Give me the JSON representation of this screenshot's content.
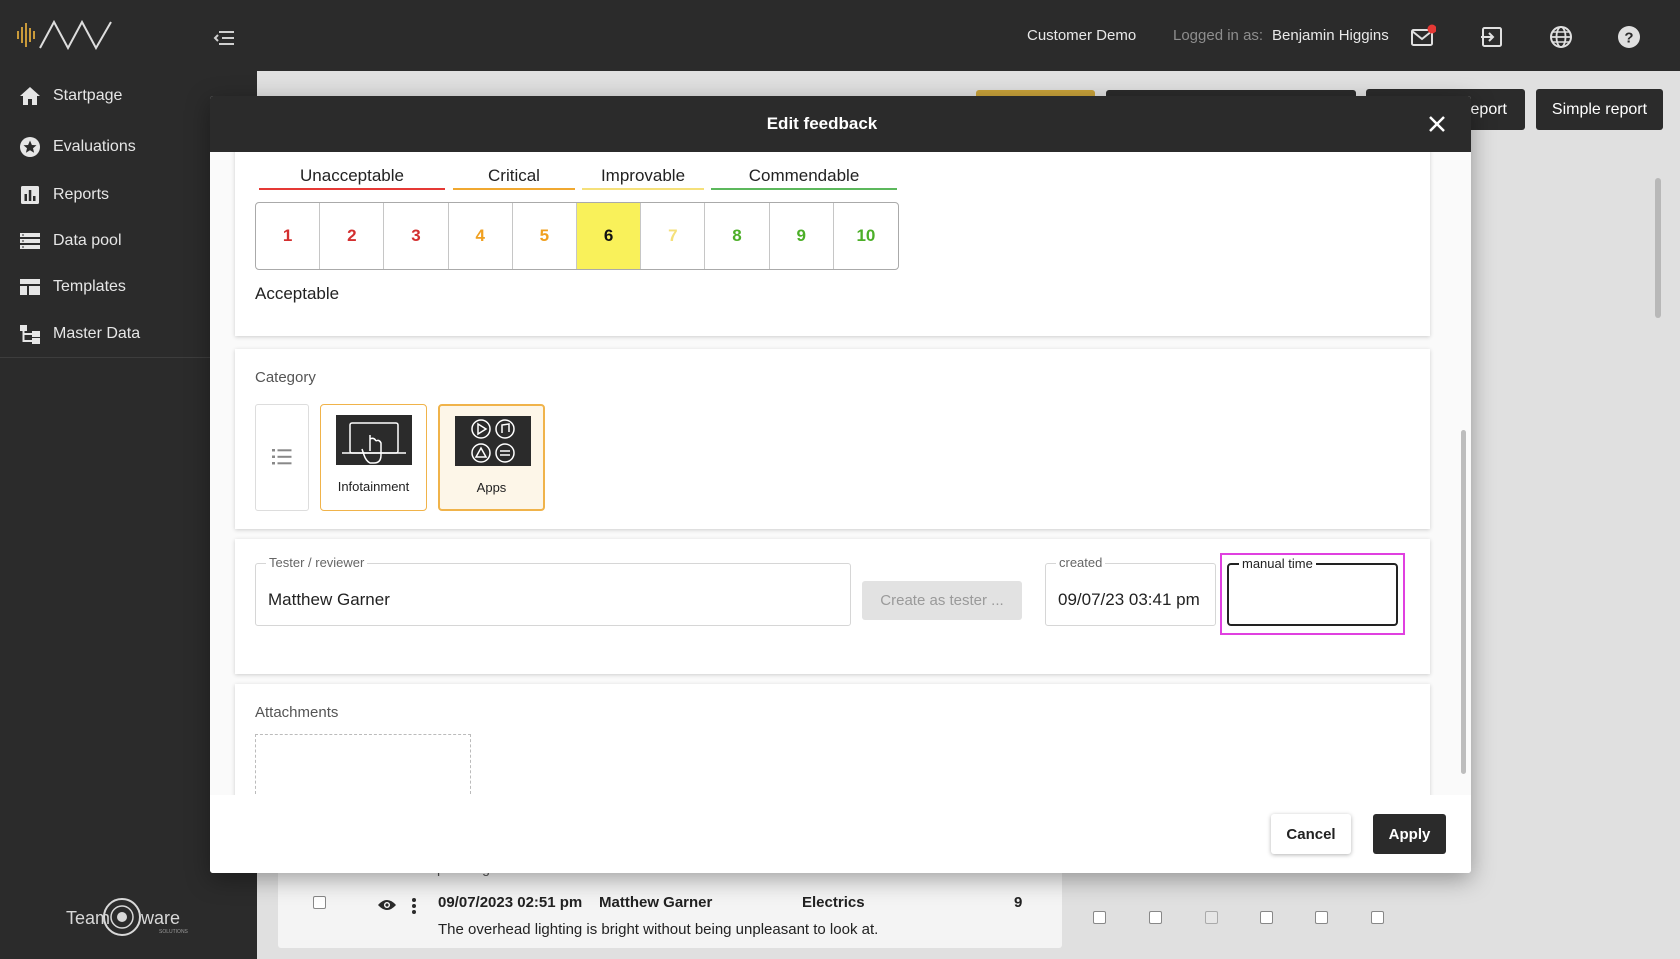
{
  "topbar": {
    "customer": "Customer Demo",
    "logged_in_label": "Logged in as:",
    "user_name": "Benjamin Higgins",
    "icons": [
      "mail-icon",
      "logout-icon",
      "globe-icon",
      "help-icon"
    ],
    "notification_color": "#e53935"
  },
  "sidebar": {
    "items": [
      {
        "label": "Startpage",
        "icon": "home-icon"
      },
      {
        "label": "Evaluations",
        "icon": "star-circle-icon"
      },
      {
        "label": "Reports",
        "icon": "bar-chart-icon"
      },
      {
        "label": "Data pool",
        "icon": "list-icon"
      },
      {
        "label": "Templates",
        "icon": "table-icon"
      },
      {
        "label": "Master Data",
        "icon": "hierarchy-icon"
      }
    ],
    "footer_logo": {
      "text_left": "Team",
      "text_right": "ware",
      "sub": "SOLUTIONS"
    }
  },
  "background": {
    "buttons": {
      "report_partial": "eport",
      "simple_report": "Simple report"
    },
    "row": {
      "partial_text": "passengers.",
      "datetime": "09/07/2023 02:51 pm",
      "tester": "Matthew Garner",
      "category": "Electrics",
      "score": "9",
      "comment": "The overhead lighting is bright without being unpleasant to look at."
    }
  },
  "modal": {
    "title": "Edit feedback",
    "rating": {
      "groups": [
        {
          "label": "Unacceptable",
          "color": "#e53935"
        },
        {
          "label": "Critical",
          "color": "#f0a830"
        },
        {
          "label": "Improvable",
          "color": "#f5e07a"
        },
        {
          "label": "Commendable",
          "color": "#5cb85c"
        }
      ],
      "scale": [
        {
          "value": "1",
          "color": "#d32f2f"
        },
        {
          "value": "2",
          "color": "#d32f2f"
        },
        {
          "value": "3",
          "color": "#d32f2f"
        },
        {
          "value": "4",
          "color": "#f0a020"
        },
        {
          "value": "5",
          "color": "#f0a020"
        },
        {
          "value": "6",
          "color": "#111111"
        },
        {
          "value": "7",
          "color": "#f5e07a"
        },
        {
          "value": "8",
          "color": "#4caf28"
        },
        {
          "value": "9",
          "color": "#4caf28"
        },
        {
          "value": "10",
          "color": "#4caf28"
        }
      ],
      "selected": "6",
      "selected_color": "#f9f15a",
      "caption": "Acceptable"
    },
    "category": {
      "label": "Category",
      "tiles": [
        {
          "label": "Infotainment",
          "selected": false
        },
        {
          "label": "Apps",
          "selected": true
        }
      ],
      "accent": "#f0b34a"
    },
    "tester": {
      "label": "Tester / reviewer",
      "value": "Matthew Garner",
      "create_button": "Create as tester ...",
      "created_label": "created",
      "created_value": "09/07/23 03:41 pm",
      "manual_time_label": "manual time",
      "manual_time_value": "",
      "highlight_color": "#e040e0"
    },
    "attachments": {
      "label": "Attachments"
    },
    "buttons": {
      "cancel": "Cancel",
      "apply": "Apply"
    }
  }
}
